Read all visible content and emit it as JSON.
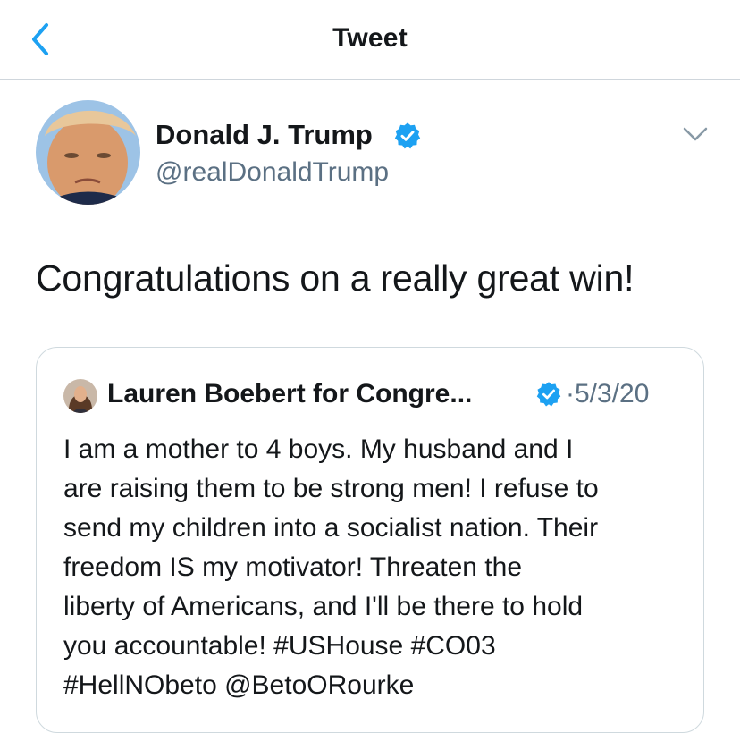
{
  "header": {
    "title": "Tweet",
    "back_icon": "chevron-left-icon",
    "accent_color": "#1da1f2"
  },
  "tweet": {
    "author_name": "Donald J. Trump",
    "author_handle": "@realDonaldTrump",
    "verified": true,
    "text": "Congratulations on a really great win!",
    "more_icon": "chevron-down-icon"
  },
  "quoted_tweet": {
    "author_name": "Lauren Boebert for Congre...",
    "verified": true,
    "date": "·5/3/20",
    "lines": [
      "I am a mother to 4 boys. My husband and I",
      "are raising them to be strong men! I refuse to",
      "send my children into a socialist nation. Their",
      "freedom IS my motivator! Threaten the",
      "liberty of Americans, and I'll be there to hold",
      "you accountable! #USHouse #CO03",
      "#HellNObeto @BetoORourke"
    ]
  }
}
